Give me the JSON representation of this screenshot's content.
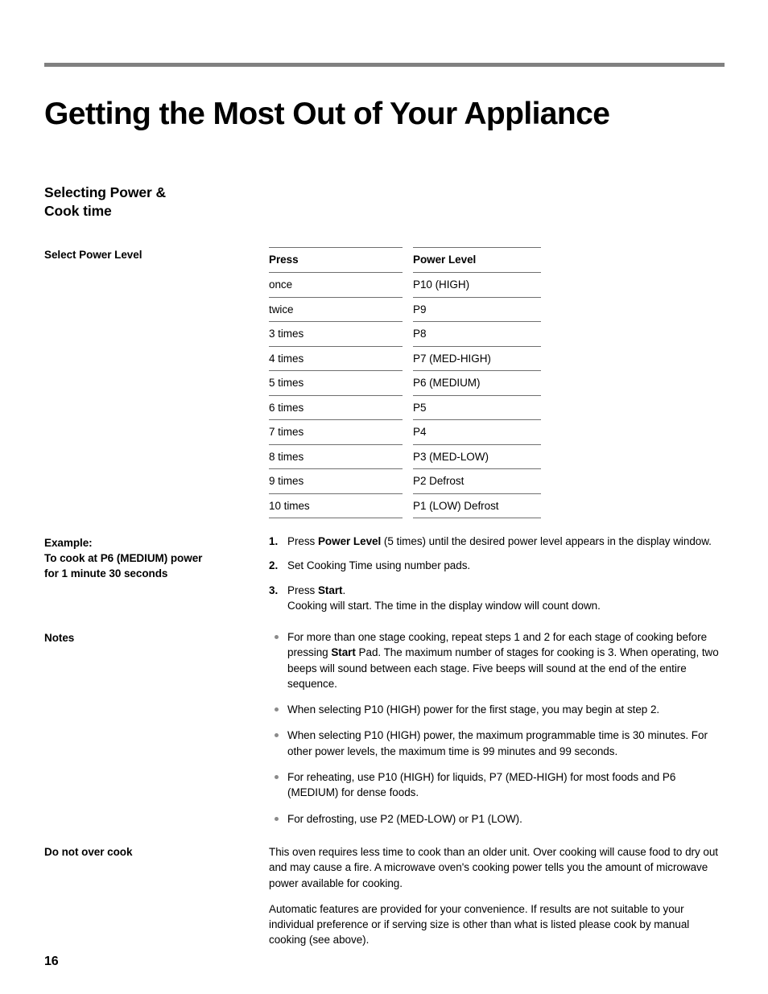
{
  "page": {
    "title": "Getting the Most Out of Your Appliance",
    "number": "16",
    "rule_color": "#808080"
  },
  "section": {
    "heading_line1": "Selecting Power &",
    "heading_line2": "Cook time"
  },
  "labels": {
    "select_power_level": "Select Power Level",
    "example_line1": "Example:",
    "example_line2": "To cook at P6 (MEDIUM) power",
    "example_line3": "for 1 minute 30 seconds",
    "notes": "Notes",
    "do_not_over_cook": "Do not over cook"
  },
  "power_table": {
    "headers": [
      "Press",
      "Power Level"
    ],
    "rows": [
      [
        "once",
        "P10 (HIGH)"
      ],
      [
        "twice",
        "P9"
      ],
      [
        "3 times",
        "P8"
      ],
      [
        "4 times",
        "P7 (MED-HIGH)"
      ],
      [
        "5 times",
        "P6 (MEDIUM)"
      ],
      [
        "6 times",
        "P5"
      ],
      [
        "7 times",
        "P4"
      ],
      [
        "8 times",
        "P3 (MED-LOW)"
      ],
      [
        "9 times",
        "P2 Defrost"
      ],
      [
        "10 times",
        "P1 (LOW) Defrost"
      ]
    ]
  },
  "steps": [
    {
      "number": "1.",
      "parts": [
        {
          "text": "Press ",
          "bold": false
        },
        {
          "text": "Power Level",
          "bold": true
        },
        {
          "text": " (5 times) until the desired power level appears in the display window.",
          "bold": false
        }
      ]
    },
    {
      "number": "2.",
      "parts": [
        {
          "text": "Set Cooking Time using number pads.",
          "bold": false
        }
      ]
    },
    {
      "number": "3.",
      "parts": [
        {
          "text": "Press ",
          "bold": false
        },
        {
          "text": "Start",
          "bold": true
        },
        {
          "text": ".",
          "bold": false
        },
        {
          "text": "\n",
          "bold": false
        },
        {
          "text": "Cooking will start. The time in the display window will count down.",
          "bold": false
        }
      ]
    }
  ],
  "notes": [
    {
      "parts": [
        {
          "text": "For more than one stage cooking, repeat steps 1 and 2 for each stage of cooking before pressing ",
          "bold": false
        },
        {
          "text": "Start",
          "bold": true
        },
        {
          "text": " Pad. The maximum number of stages for cooking is 3. When operating, two beeps will sound between each stage. Five beeps will sound at the end of the entire sequence.",
          "bold": false
        }
      ]
    },
    {
      "parts": [
        {
          "text": "When selecting P10 (HIGH) power for the first stage, you may begin at step 2.",
          "bold": false
        }
      ]
    },
    {
      "parts": [
        {
          "text": "When selecting P10 (HIGH) power, the maximum programmable time is 30 minutes. For other power levels, the maximum time is 99 minutes and 99 seconds.",
          "bold": false
        }
      ]
    },
    {
      "parts": [
        {
          "text": "For reheating, use P10 (HIGH) for liquids, P7 (MED-HIGH) for most foods and P6 (MEDIUM) for dense foods.",
          "bold": false
        }
      ]
    },
    {
      "parts": [
        {
          "text": "For defrosting, use P2 (MED-LOW) or P1 (LOW).",
          "bold": false
        }
      ]
    }
  ],
  "do_not_over_cook": {
    "paragraphs": [
      "This oven requires less time to cook than an older unit. Over cooking will cause food to dry out and may cause a fire. A microwave oven's cooking power tells you the amount of microwave power available for cooking.",
      "Automatic features are provided for your convenience. If results are not suitable to your individual preference or if serving size is other than what is listed please cook by manual cooking (see above)."
    ]
  }
}
